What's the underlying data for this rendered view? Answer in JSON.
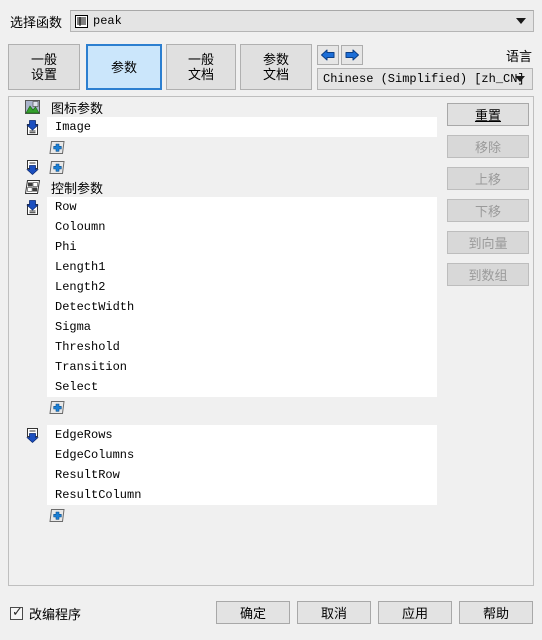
{
  "window": {
    "function_label": "选择函数",
    "function_value": "peak",
    "function_icon": "document-grid-icon"
  },
  "tabs": [
    {
      "name": "tab-general-settings",
      "line1": "一般",
      "line2": "设置",
      "selected": false
    },
    {
      "name": "tab-parameters",
      "line1": "参数",
      "line2": "",
      "selected": true
    },
    {
      "name": "tab-general-doc",
      "line1": "一般",
      "line2": "文档",
      "selected": false
    },
    {
      "name": "tab-parameter-doc",
      "line1": "参数",
      "line2": "文档",
      "selected": false
    }
  ],
  "nav": {
    "back_icon": "arrow-left-icon",
    "forward_icon": "arrow-right-icon"
  },
  "language": {
    "label": "语言",
    "value": "Chinese (Simplified) [zh_CN]"
  },
  "groups": [
    {
      "header": {
        "icon": "image-parameter-icon",
        "label": "图标参数"
      },
      "sections": [
        {
          "icon": "input-parameter-icon",
          "items": [
            "Image"
          ],
          "add_icon": "add-parameter-icon"
        },
        {
          "icon": "output-parameter-icon",
          "items": [],
          "add_icon": "add-parameter-icon"
        }
      ]
    },
    {
      "header": {
        "icon": "control-parameter-icon",
        "label": "控制参数"
      },
      "sections": [
        {
          "icon": "input-parameter-icon",
          "items": [
            "Row",
            "Coloumn",
            "Phi",
            "Length1",
            "Length2",
            "DetectWidth",
            "Sigma",
            "Threshold",
            "Transition",
            "Select"
          ],
          "add_icon": "add-parameter-icon"
        },
        {
          "icon": "output-parameter-icon",
          "items": [
            "EdgeRows",
            "EdgeColumns",
            "ResultRow",
            "ResultColumn"
          ],
          "add_icon": "add-parameter-icon"
        }
      ]
    }
  ],
  "side_buttons": [
    {
      "name": "reset-button",
      "label": "重置",
      "enabled": true,
      "underline": true
    },
    {
      "name": "remove-button",
      "label": "移除",
      "enabled": false,
      "underline": false
    },
    {
      "name": "move-up-button",
      "label": "上移",
      "enabled": false,
      "underline": false
    },
    {
      "name": "move-down-button",
      "label": "下移",
      "enabled": false,
      "underline": false
    },
    {
      "name": "to-vector-button",
      "label": "到向量",
      "enabled": false,
      "underline": false
    },
    {
      "name": "to-array-button",
      "label": "到数组",
      "enabled": false,
      "underline": false
    }
  ],
  "footer": {
    "checkbox_label": "改编程序",
    "checkbox_checked": true,
    "buttons": [
      {
        "name": "ok-button",
        "label": "确定"
      },
      {
        "name": "cancel-button",
        "label": "取消"
      },
      {
        "name": "apply-button",
        "label": "应用"
      },
      {
        "name": "help-button",
        "label": "帮助"
      }
    ]
  },
  "colors": {
    "selected_tab_bg": "#cbe6fb",
    "selected_tab_border": "#2c7fd0",
    "panel_bg": "#f0f0f0",
    "list_bg": "#ffffff",
    "accent_blue": "#1155cc"
  }
}
